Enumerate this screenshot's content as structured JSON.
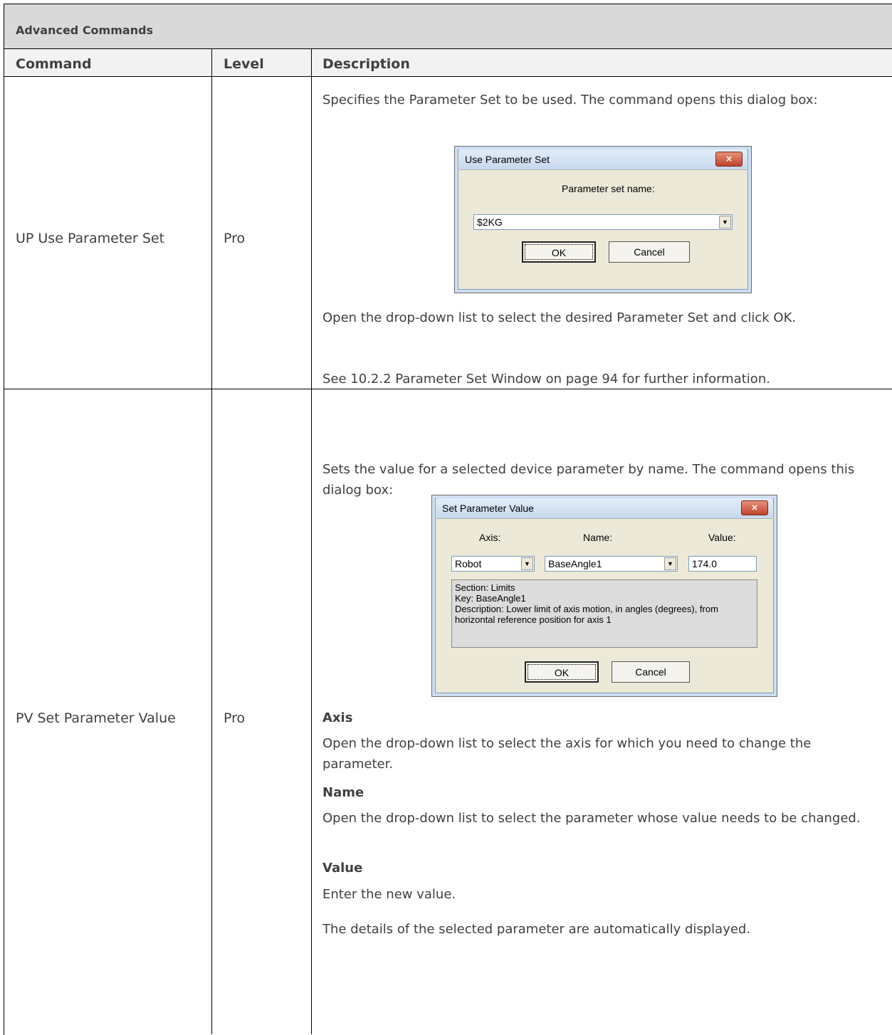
{
  "table": {
    "title": "Advanced Commands",
    "headers": {
      "command": "Command",
      "level": "Level",
      "description": "Description"
    },
    "rows": [
      {
        "command": "UP Use Parameter Set",
        "level": "Pro",
        "intro": "Specifies the Parameter Set to be used. The command opens this dialog box:",
        "after": "Open the drop-down list to select the desired Parameter Set and click OK.",
        "see": "See 10.2.2 Parameter Set Window on page 94 for further information."
      },
      {
        "command": "PV Set Parameter Value",
        "level": "Pro",
        "intro": "Sets the value for a selected device parameter by name. The command opens this dialog box:",
        "sections": [
          {
            "heading": "Axis",
            "text": "Open the drop-down list to select the axis for which you need to change the parameter."
          },
          {
            "heading": "Name",
            "text": "Open the drop-down list to select the parameter whose value needs to be changed."
          },
          {
            "heading": "Value",
            "text": "Enter the new value."
          }
        ],
        "closing": "The details of the selected parameter are automatically displayed."
      }
    ]
  },
  "dialog_use_param": {
    "title": "Use Parameter Set",
    "close_icon": "×",
    "label": "Parameter set name:",
    "value": "$2KG",
    "ok": "OK",
    "cancel": "Cancel"
  },
  "dialog_set_param": {
    "title": "Set Parameter Value",
    "close_icon": "×",
    "axis_label": "Axis:",
    "name_label": "Name:",
    "value_label": "Value:",
    "axis_value": "Robot",
    "name_value": "BaseAngle1",
    "value_value": "174.0",
    "info_section": "Section:  Limits",
    "info_key": "Key:  BaseAngle1",
    "info_desc": "Description:  Lower limit of axis motion, in angles (degrees), from horizontal reference position for axis  1",
    "ok": "OK",
    "cancel": "Cancel"
  }
}
